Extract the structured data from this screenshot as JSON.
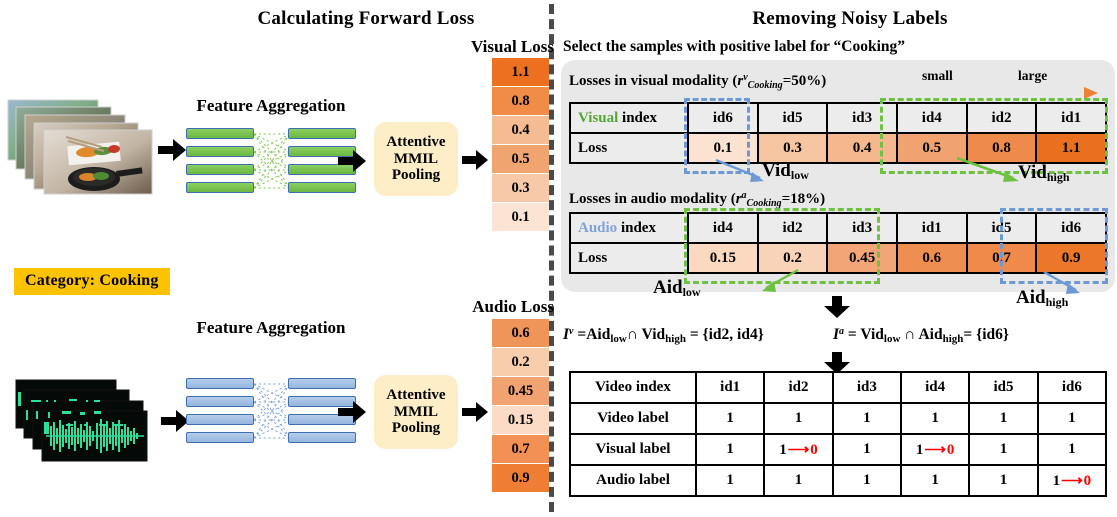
{
  "panels": {
    "left_title": "Calculating Forward Loss",
    "right_title": "Removing Noisy Labels"
  },
  "left": {
    "visual": {
      "feature_aggregation_label": "Feature Aggregation",
      "pooling_label": "Attentive\nMMIL\nPooling",
      "pooling_line1": "Attentive",
      "pooling_line2": "MMIL",
      "pooling_line3": "Pooling",
      "loss_title": "Visual Loss",
      "loss_values": [
        "1.1",
        "0.8",
        "0.4",
        "0.5",
        "0.3",
        "0.1"
      ],
      "loss_colors": [
        "#ec7020",
        "#f08c47",
        "#f5bb93",
        "#f0a571",
        "#f7c9a8",
        "#fce4d4"
      ]
    },
    "audio": {
      "feature_aggregation_label": "Feature Aggregation",
      "pooling_line1": "Attentive",
      "pooling_line2": "MMIL",
      "pooling_line3": "Pooling",
      "loss_title": "Audio Loss",
      "loss_values": [
        "0.6",
        "0.2",
        "0.45",
        "0.15",
        "0.7",
        "0.9"
      ],
      "loss_colors": [
        "#f0955a",
        "#f8cdac",
        "#f2a271",
        "#fbdbc6",
        "#f29055",
        "#ef7e34"
      ]
    },
    "category_badge": "Category: Cooking"
  },
  "right": {
    "select_text": "Select the samples with positive label for “Cooking”",
    "visual_modality": {
      "caption_prefix": "Losses in visual modality (",
      "caption_r": "r",
      "caption_sup": "v",
      "caption_sub": "Cooking",
      "caption_eq": "=50%)",
      "scale_small": "small",
      "scale_large": "large",
      "row_header_colored": "Visual",
      "row_header_rest": " index",
      "loss_row_label": "Loss",
      "indices": [
        "id6",
        "id5",
        "id3",
        "id4",
        "id2",
        "id1"
      ],
      "losses": [
        "0.1",
        "0.3",
        "0.4",
        "0.5",
        "0.8",
        "1.1"
      ],
      "loss_colors": [
        "#fce2d0",
        "#f6c6a3",
        "#f4b78e",
        "#f0a271",
        "#ee8a4b",
        "#e8701e"
      ],
      "low_tag": "Vid",
      "low_tag_sub": "low",
      "high_tag": "Vid",
      "high_tag_sub": "high"
    },
    "audio_modality": {
      "caption_prefix": "Losses in audio modality (",
      "caption_r": "r",
      "caption_sup": "a",
      "caption_sub": "Cooking",
      "caption_eq": "=18%)",
      "row_header_colored": "Audio",
      "row_header_rest": " index",
      "loss_row_label": "Loss",
      "indices": [
        "id4",
        "id2",
        "id3",
        "id1",
        "id5",
        "id6"
      ],
      "losses": [
        "0.15",
        "0.2",
        "0.45",
        "0.6",
        "0.7",
        "0.9"
      ],
      "loss_colors": [
        "#fbd9c1",
        "#f9d3b8",
        "#f2a677",
        "#ef8e51",
        "#ef8a4a",
        "#ec7728"
      ],
      "low_tag": "Aid",
      "low_tag_sub": "low",
      "high_tag": "Aid",
      "high_tag_sub": "high"
    },
    "formula_visual": "I^v = Aid_low ∩ Vid_high = {id2, id4}",
    "formula_audio": "I^a = Vid_low ∩ Aid_high = {id6}",
    "formula_visual_parts": {
      "I": "I",
      "sup": "v",
      "eq1": " =",
      "t1": "Aid",
      "s1": "low",
      "cap": "∩",
      "t2": "Vid",
      "s2": "high",
      "eq2": "= {id2, id4}"
    },
    "formula_audio_parts": {
      "I": "I",
      "sup": "a",
      "eq1": " =",
      "t1": "Vid",
      "s1": "low",
      "cap": "∩",
      "t2": "Aid",
      "s2": "high",
      "eq2": "= {id6}"
    },
    "final_table": {
      "row_labels": [
        "Video index",
        "Video label",
        "Visual label",
        "Audio label"
      ],
      "indices": [
        "id1",
        "id2",
        "id3",
        "id4",
        "id5",
        "id6"
      ],
      "video_label": [
        "1",
        "1",
        "1",
        "1",
        "1",
        "1"
      ],
      "visual_label": [
        "1",
        "1→0",
        "1",
        "1→0",
        "1",
        "1"
      ],
      "audio_label": [
        "1",
        "1",
        "1",
        "1",
        "1",
        "1→0"
      ],
      "visual_label_changed": [
        false,
        true,
        false,
        true,
        false,
        false
      ],
      "audio_label_changed": [
        false,
        false,
        false,
        false,
        false,
        true
      ]
    }
  },
  "colors": {
    "accent_green": "#6fc241",
    "accent_blue": "#6e9ad4",
    "accent_orange": "#ec7020",
    "badge_yellow": "#fdc300",
    "red": "#ff0000",
    "panel_gray": "#e8e8e8",
    "pool_cream": "#fdeec8"
  }
}
